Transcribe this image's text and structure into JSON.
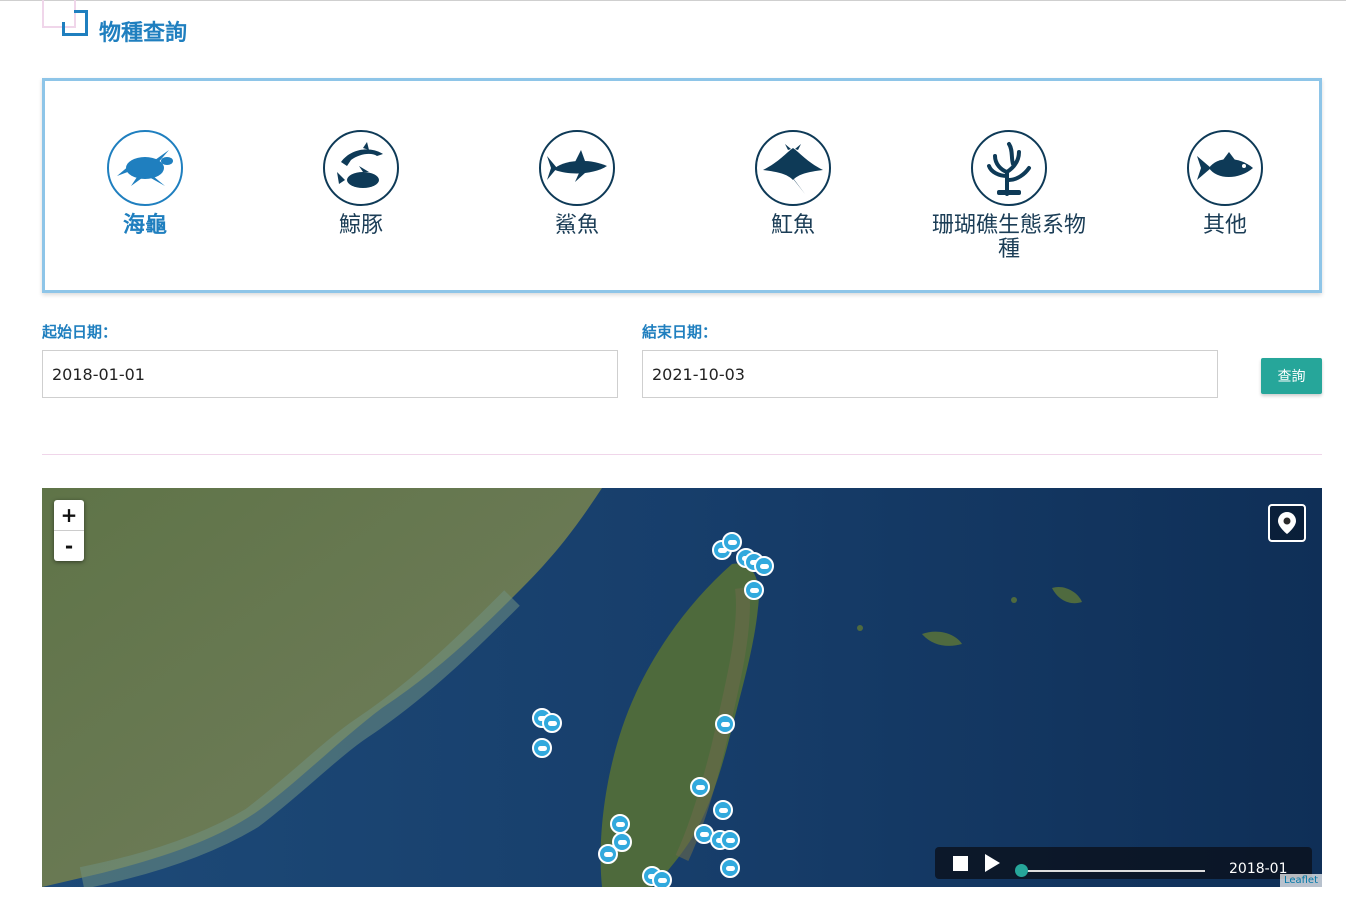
{
  "header": {
    "title": "物種查詢"
  },
  "species": [
    {
      "label": "海龜",
      "icon": "sea-turtle-icon",
      "active": true
    },
    {
      "label": "鯨豚",
      "icon": "dolphin-icon",
      "active": false
    },
    {
      "label": "鯊魚",
      "icon": "shark-icon",
      "active": false
    },
    {
      "label": "魟魚",
      "icon": "manta-ray-icon",
      "active": false
    },
    {
      "label": "珊瑚礁生態系物\n種",
      "icon": "coral-icon",
      "active": false
    },
    {
      "label": "其他",
      "icon": "fish-icon",
      "active": false
    }
  ],
  "search": {
    "start_label": "起始日期：",
    "start_value": "2018-01-01",
    "end_label": "結束日期：",
    "end_value": "2021-10-03",
    "button_label": "查詢"
  },
  "map": {
    "zoom_in": "+",
    "zoom_out": "-",
    "time_label": "2018-01",
    "attribution": "Leaflet",
    "marker_icon": "turtle-marker-icon",
    "colors": {
      "marker": "#31a9dd",
      "slider_knob": "#26a69a"
    }
  },
  "colors": {
    "accent": "#1f7fbf",
    "button": "#26a69a",
    "box_border": "#8ec5e8"
  }
}
